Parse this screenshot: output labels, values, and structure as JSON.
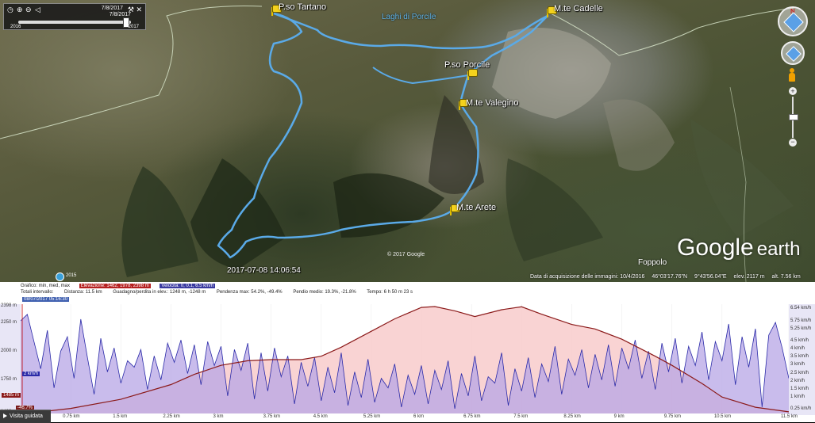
{
  "map": {
    "lake_label": "Laghi di Porcile",
    "places": [
      {
        "name": "P.so Tartano"
      },
      {
        "name": "M.te Cadelle"
      },
      {
        "name": "P.so Porcile"
      },
      {
        "name": "M.te Valegino"
      },
      {
        "name": "M.te Arete"
      }
    ],
    "tour_timestamp": "2017-07-08 14:06:54",
    "copyright": "© 2017 Google",
    "town": "Foppolo",
    "logo": {
      "google": "Google",
      "earth": "earth"
    },
    "mini_year": "2015",
    "status": {
      "acq_date": "Data di acquisizione delle immagini: 10/4/2016",
      "lat": "46°03'17.76\"N",
      "lon": "9°43'56.04\"E",
      "elev": "elev. 2117 m",
      "alt": "alt. 7.56 km"
    },
    "route_color": "#5aaae8",
    "pin_color": "#f4d21d"
  },
  "time_slider": {
    "date_top": "7/8/2017",
    "date_bottom": "7/8/2017",
    "year_start": "2016",
    "year_end": "2017"
  },
  "profile": {
    "graph_title": "Grafico: min, med, max",
    "elevation_stats": "Elevazione: 1462, 1978, 2398 m",
    "speed_stats": "Velocità: 0, 0.1, 6.5 km/h",
    "totals_label": "Totali intervallo:",
    "distance": "Distanza: 11.5 km",
    "gain_loss": "Guadagno/perdita in elev.: 1248 m, -1248 m",
    "max_slope": "Pendenza max: 54.2%, -49.4%",
    "avg_slope": "Pendio medio: 19.3%, -21.8%",
    "time": "Tempo: 6 h 50 m 23 s",
    "date_stamp": "08/07/2017 05:16:30",
    "cursor_speed": "2 km/h",
    "cursor_elev": "1485 m",
    "cursor_slope": "-46.7%",
    "tour_button": "Visita guidata",
    "elev_color": "#8b1a1a",
    "speed_color": "#2a2aa8"
  },
  "chart_data": {
    "type": "area",
    "x_unit": "km",
    "x_ticks": [
      "0.75 km",
      "1.5 km",
      "2.25 km",
      "3 km",
      "3.75 km",
      "4.5 km",
      "5.25 km",
      "6 km",
      "6.75 km",
      "7.5 km",
      "8.25 km",
      "9 km",
      "9.75 km",
      "10.5 km",
      "11.5 km"
    ],
    "x_tick_values": [
      0.75,
      1.5,
      2.25,
      3,
      3.75,
      4.5,
      5.25,
      6,
      6.75,
      7.5,
      8.25,
      9,
      9.75,
      10.5,
      11.5
    ],
    "y_left_ticks": [
      "2398 m",
      "2250 m",
      "2000 m",
      "1750 m",
      "1462 m"
    ],
    "y_left_values": [
      2398,
      2250,
      2000,
      1750,
      1462
    ],
    "y_right_ticks": [
      "6.54 km/h",
      "5.75 km/h",
      "5.25 km/h",
      "4.5 km/h",
      "4 km/h",
      "3.5 km/h",
      "3 km/h",
      "2.5 km/h",
      "2 km/h",
      "1.5 km/h",
      "1 km/h",
      "0.25 km/h"
    ],
    "y_right_values": [
      6.54,
      5.75,
      5.25,
      4.5,
      4,
      3.5,
      3,
      2.5,
      2,
      1.5,
      1,
      0.25
    ],
    "xlim": [
      0,
      11.5
    ],
    "ylim_left": [
      1462,
      2398
    ],
    "ylim_right": [
      0,
      6.54
    ],
    "series": [
      {
        "name": "Elevazione",
        "axis": "left",
        "x": [
          0,
          0.3,
          0.75,
          1.5,
          2.25,
          2.6,
          3,
          3.4,
          3.75,
          4.2,
          4.5,
          4.8,
          5.25,
          5.6,
          6,
          6.2,
          6.5,
          6.8,
          7.2,
          7.5,
          7.8,
          8.25,
          8.6,
          9,
          9.5,
          9.75,
          10.2,
          10.5,
          11,
          11.5
        ],
        "y": [
          1462,
          1470,
          1500,
          1580,
          1710,
          1800,
          1880,
          1920,
          1930,
          1930,
          1960,
          2040,
          2180,
          2290,
          2390,
          2398,
          2360,
          2310,
          2370,
          2396,
          2330,
          2240,
          2200,
          2110,
          1960,
          1880,
          1720,
          1600,
          1510,
          1470
        ]
      },
      {
        "name": "Velocità",
        "axis": "right",
        "x": [
          0,
          0.1,
          0.2,
          0.3,
          0.4,
          0.5,
          0.6,
          0.7,
          0.8,
          0.9,
          1.0,
          1.1,
          1.2,
          1.3,
          1.4,
          1.5,
          1.6,
          1.7,
          1.8,
          1.9,
          2.0,
          2.1,
          2.2,
          2.3,
          2.4,
          2.5,
          2.6,
          2.7,
          2.8,
          2.9,
          3.0,
          3.1,
          3.2,
          3.3,
          3.4,
          3.5,
          3.6,
          3.7,
          3.8,
          3.9,
          4.0,
          4.1,
          4.2,
          4.3,
          4.4,
          4.5,
          4.6,
          4.7,
          4.8,
          4.9,
          5.0,
          5.1,
          5.2,
          5.3,
          5.4,
          5.5,
          5.6,
          5.7,
          5.8,
          5.9,
          6.0,
          6.1,
          6.2,
          6.3,
          6.4,
          6.5,
          6.6,
          6.7,
          6.8,
          6.9,
          7.0,
          7.1,
          7.2,
          7.3,
          7.4,
          7.5,
          7.6,
          7.7,
          7.8,
          7.9,
          8.0,
          8.1,
          8.2,
          8.3,
          8.4,
          8.5,
          8.6,
          8.7,
          8.8,
          8.9,
          9.0,
          9.1,
          9.2,
          9.3,
          9.4,
          9.5,
          9.6,
          9.7,
          9.8,
          9.9,
          10.0,
          10.1,
          10.2,
          10.3,
          10.4,
          10.5,
          10.6,
          10.7,
          10.8,
          10.9,
          11.0,
          11.1,
          11.2,
          11.3,
          11.4,
          11.5
        ],
        "y": [
          5.8,
          6.2,
          4.5,
          2.8,
          5.2,
          1.6,
          3.9,
          4.8,
          2.2,
          5.9,
          3.5,
          1.2,
          4.7,
          2.6,
          4.1,
          1.9,
          3.3,
          2.9,
          4.0,
          1.5,
          3.6,
          2.1,
          4.4,
          3.2,
          4.6,
          2.5,
          4.3,
          1.8,
          4.5,
          3.0,
          4.2,
          1.1,
          4.0,
          2.7,
          4.4,
          0.9,
          3.8,
          1.4,
          4.1,
          2.3,
          3.6,
          0.6,
          3.2,
          1.7,
          3.5,
          0.8,
          2.9,
          1.3,
          3.8,
          0.5,
          2.6,
          1.0,
          3.4,
          0.7,
          2.2,
          1.6,
          3.1,
          0.4,
          2.4,
          1.2,
          3.0,
          0.6,
          2.7,
          1.5,
          3.3,
          0.3,
          2.5,
          1.1,
          3.6,
          0.8,
          2.3,
          1.9,
          3.8,
          0.5,
          2.8,
          1.4,
          3.5,
          1.0,
          3.1,
          2.0,
          4.2,
          1.2,
          3.4,
          2.4,
          4.0,
          1.6,
          3.7,
          2.1,
          4.3,
          1.7,
          4.1,
          2.8,
          4.6,
          2.2,
          3.9,
          1.5,
          4.4,
          2.6,
          4.7,
          1.9,
          4.2,
          3.0,
          5.1,
          2.1,
          4.5,
          3.3,
          5.6,
          1.8,
          4.8,
          2.9,
          5.3,
          0.4,
          4.9,
          5.7,
          4.1,
          2.2
        ]
      }
    ]
  }
}
